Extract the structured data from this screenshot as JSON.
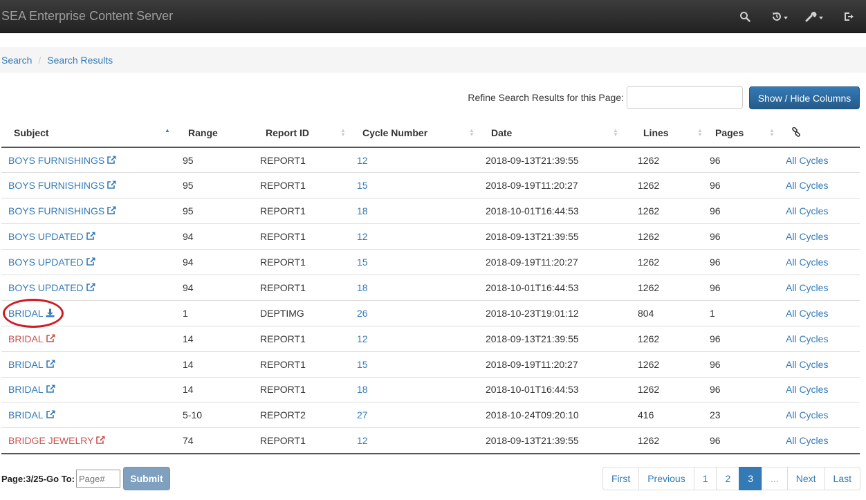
{
  "app": {
    "title": "SEA Enterprise Content Server"
  },
  "nav_icons": [
    "search-icon",
    "history-icon",
    "wrench-icon",
    "logout-icon"
  ],
  "breadcrumb": {
    "items": [
      "Search",
      "Search Results"
    ]
  },
  "refine": {
    "label": "Refine Search Results for this Page:",
    "value": "",
    "button": "Show / Hide Columns"
  },
  "table": {
    "headers": [
      "Subject",
      "Range",
      "Report ID",
      "Cycle Number",
      "Date",
      "Lines",
      "Pages"
    ],
    "link_column_icon": "link-icon",
    "rows": [
      {
        "subject": "BOYS FURNISHINGS",
        "icon": "external-link-icon",
        "visited": false,
        "range": "95",
        "report_id": "REPORT1",
        "cycle": "12",
        "date": "2018-09-13T21:39:55",
        "lines": "1262",
        "pages": "96",
        "link": "All Cycles"
      },
      {
        "subject": "BOYS FURNISHINGS",
        "icon": "external-link-icon",
        "visited": false,
        "range": "95",
        "report_id": "REPORT1",
        "cycle": "15",
        "date": "2018-09-19T11:20:27",
        "lines": "1262",
        "pages": "96",
        "link": "All Cycles"
      },
      {
        "subject": "BOYS FURNISHINGS",
        "icon": "external-link-icon",
        "visited": false,
        "range": "95",
        "report_id": "REPORT1",
        "cycle": "18",
        "date": "2018-10-01T16:44:53",
        "lines": "1262",
        "pages": "96",
        "link": "All Cycles"
      },
      {
        "subject": "BOYS UPDATED",
        "icon": "external-link-icon",
        "visited": false,
        "range": "94",
        "report_id": "REPORT1",
        "cycle": "12",
        "date": "2018-09-13T21:39:55",
        "lines": "1262",
        "pages": "96",
        "link": "All Cycles"
      },
      {
        "subject": "BOYS UPDATED",
        "icon": "external-link-icon",
        "visited": false,
        "range": "94",
        "report_id": "REPORT1",
        "cycle": "15",
        "date": "2018-09-19T11:20:27",
        "lines": "1262",
        "pages": "96",
        "link": "All Cycles"
      },
      {
        "subject": "BOYS UPDATED",
        "icon": "external-link-icon",
        "visited": false,
        "range": "94",
        "report_id": "REPORT1",
        "cycle": "18",
        "date": "2018-10-01T16:44:53",
        "lines": "1262",
        "pages": "96",
        "link": "All Cycles"
      },
      {
        "subject": "BRIDAL",
        "icon": "download-icon",
        "visited": false,
        "range": "1",
        "report_id": "DEPTIMG",
        "cycle": "26",
        "date": "2018-10-23T19:01:12",
        "lines": "804",
        "pages": "1",
        "link": "All Cycles"
      },
      {
        "subject": "BRIDAL",
        "icon": "external-link-icon",
        "visited": true,
        "range": "14",
        "report_id": "REPORT1",
        "cycle": "12",
        "date": "2018-09-13T21:39:55",
        "lines": "1262",
        "pages": "96",
        "link": "All Cycles"
      },
      {
        "subject": "BRIDAL",
        "icon": "external-link-icon",
        "visited": false,
        "range": "14",
        "report_id": "REPORT1",
        "cycle": "15",
        "date": "2018-09-19T11:20:27",
        "lines": "1262",
        "pages": "96",
        "link": "All Cycles"
      },
      {
        "subject": "BRIDAL",
        "icon": "external-link-icon",
        "visited": false,
        "range": "14",
        "report_id": "REPORT1",
        "cycle": "18",
        "date": "2018-10-01T16:44:53",
        "lines": "1262",
        "pages": "96",
        "link": "All Cycles"
      },
      {
        "subject": "BRIDAL",
        "icon": "external-link-icon",
        "visited": false,
        "range": "5-10",
        "report_id": "REPORT2",
        "cycle": "27",
        "date": "2018-10-24T09:20:10",
        "lines": "416",
        "pages": "23",
        "link": "All Cycles"
      },
      {
        "subject": "BRIDGE JEWELRY",
        "icon": "external-link-icon",
        "visited": true,
        "range": "74",
        "report_id": "REPORT1",
        "cycle": "12",
        "date": "2018-09-13T21:39:55",
        "lines": "1262",
        "pages": "96",
        "link": "All Cycles"
      }
    ]
  },
  "footer": {
    "goto_label": "Page:3/25-Go To:",
    "page_placeholder": "Page#",
    "submit": "Submit",
    "pagination": [
      {
        "label": "First",
        "active": false
      },
      {
        "label": "Previous",
        "active": false
      },
      {
        "label": "1",
        "active": false
      },
      {
        "label": "2",
        "active": false
      },
      {
        "label": "3",
        "active": true
      },
      {
        "label": "...",
        "active": false
      },
      {
        "label": "Next",
        "active": false
      },
      {
        "label": "Last",
        "active": false
      }
    ]
  },
  "colors": {
    "link": "#337ab7",
    "visited_link": "#c9534f",
    "highlight_circle": "#d11b24"
  }
}
